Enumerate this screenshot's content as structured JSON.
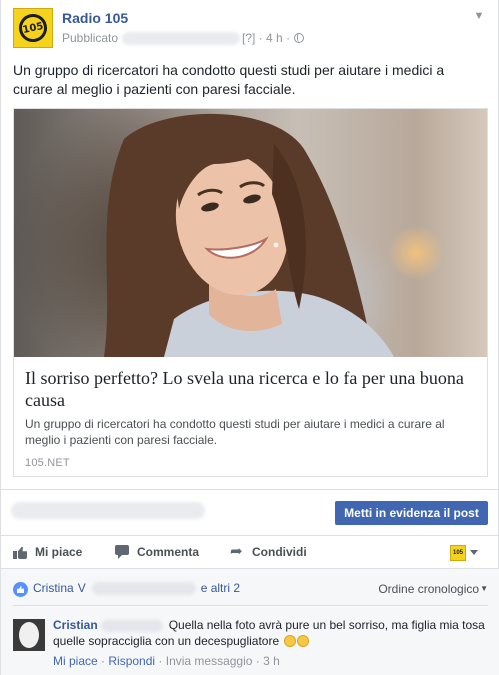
{
  "post": {
    "page_name": "Radio 105",
    "logo_text": "105",
    "published_label": "Pubblicato",
    "meta_suffix": "[?] · 4 h ·",
    "text": "Un gruppo di ricercatori ha condotto questi studi per aiutare i medici a curare al meglio i pazienti con paresi facciale."
  },
  "link": {
    "title": "Il sorriso perfetto? Lo svela una ricerca e lo fa per una buona causa",
    "description": "Un gruppo di ricercatori ha condotto questi studi per aiutare i medici a curare al meglio i pazienti con paresi facciale.",
    "domain": "105.NET"
  },
  "insights": {
    "boost_label": "Metti in evidenza il post"
  },
  "actions": {
    "like": "Mi piace",
    "comment": "Commenta",
    "share": "Condividi",
    "page_avatar_text": "105"
  },
  "reactions": {
    "first_name": "Cristina",
    "first_initial": "V",
    "others": "e altri 2",
    "order": "Ordine cronologico"
  },
  "comment": {
    "author": "Cristian",
    "text": "Quella nella foto avrà pure un bel sorriso, ma figlia mia tosa quelle sopracciglia con un decespugliatore",
    "like": "Mi piace",
    "reply": "Rispondi",
    "message": "Invia messaggio",
    "time": "3 h"
  }
}
